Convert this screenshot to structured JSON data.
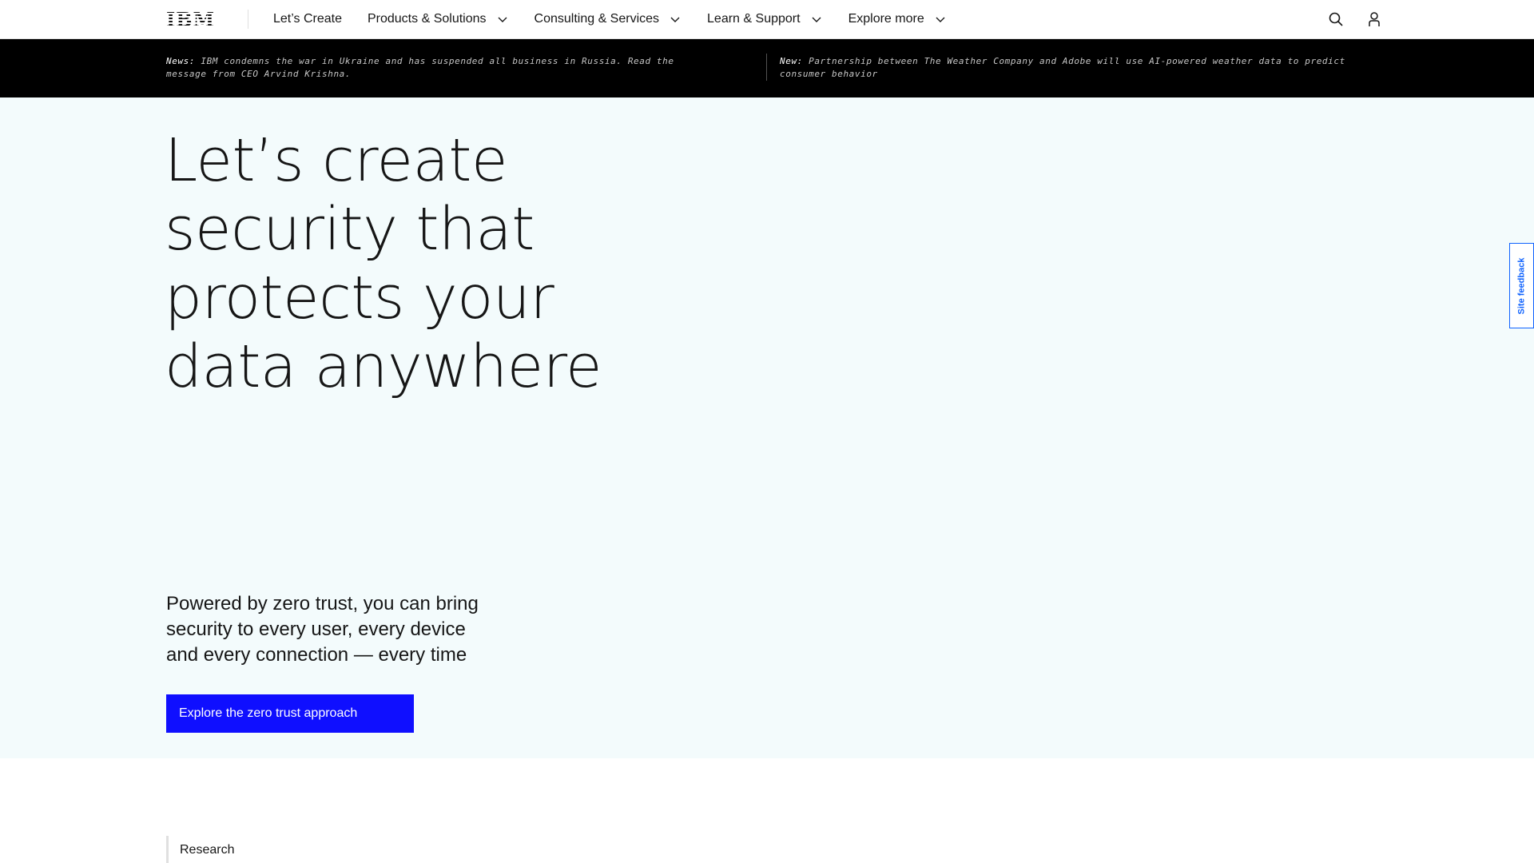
{
  "nav": {
    "logo": "IBM",
    "items": [
      {
        "label": "Let’s Create",
        "dropdown": false
      },
      {
        "label": "Products & Solutions",
        "dropdown": true
      },
      {
        "label": "Consulting & Services",
        "dropdown": true
      },
      {
        "label": "Learn & Support",
        "dropdown": true
      },
      {
        "label": "Explore more",
        "dropdown": true
      }
    ],
    "icons": [
      "search-icon",
      "user-icon"
    ]
  },
  "news": [
    {
      "tag": "News:",
      "text": " IBM condemns the war in Ukraine and has suspended all business in Russia. Read the message from CEO Arvind Krishna."
    },
    {
      "tag": "New:",
      "text": " Partnership between The Weather Company and Adobe will use AI-powered weather data to predict consumer behavior"
    }
  ],
  "hero": {
    "title": "Let’s create security that protects your data anywhere",
    "subtitle": "Powered by zero trust, you can bring security to every user, every device and every connection — every time",
    "cta_label": "Explore the zero trust approach"
  },
  "feedback_label": "Site feedback",
  "section": {
    "label": "Research"
  },
  "colors": {
    "cta": "#0f0fff",
    "hero_bg": "#f3fbfc",
    "newsbar_bg": "#000000"
  }
}
